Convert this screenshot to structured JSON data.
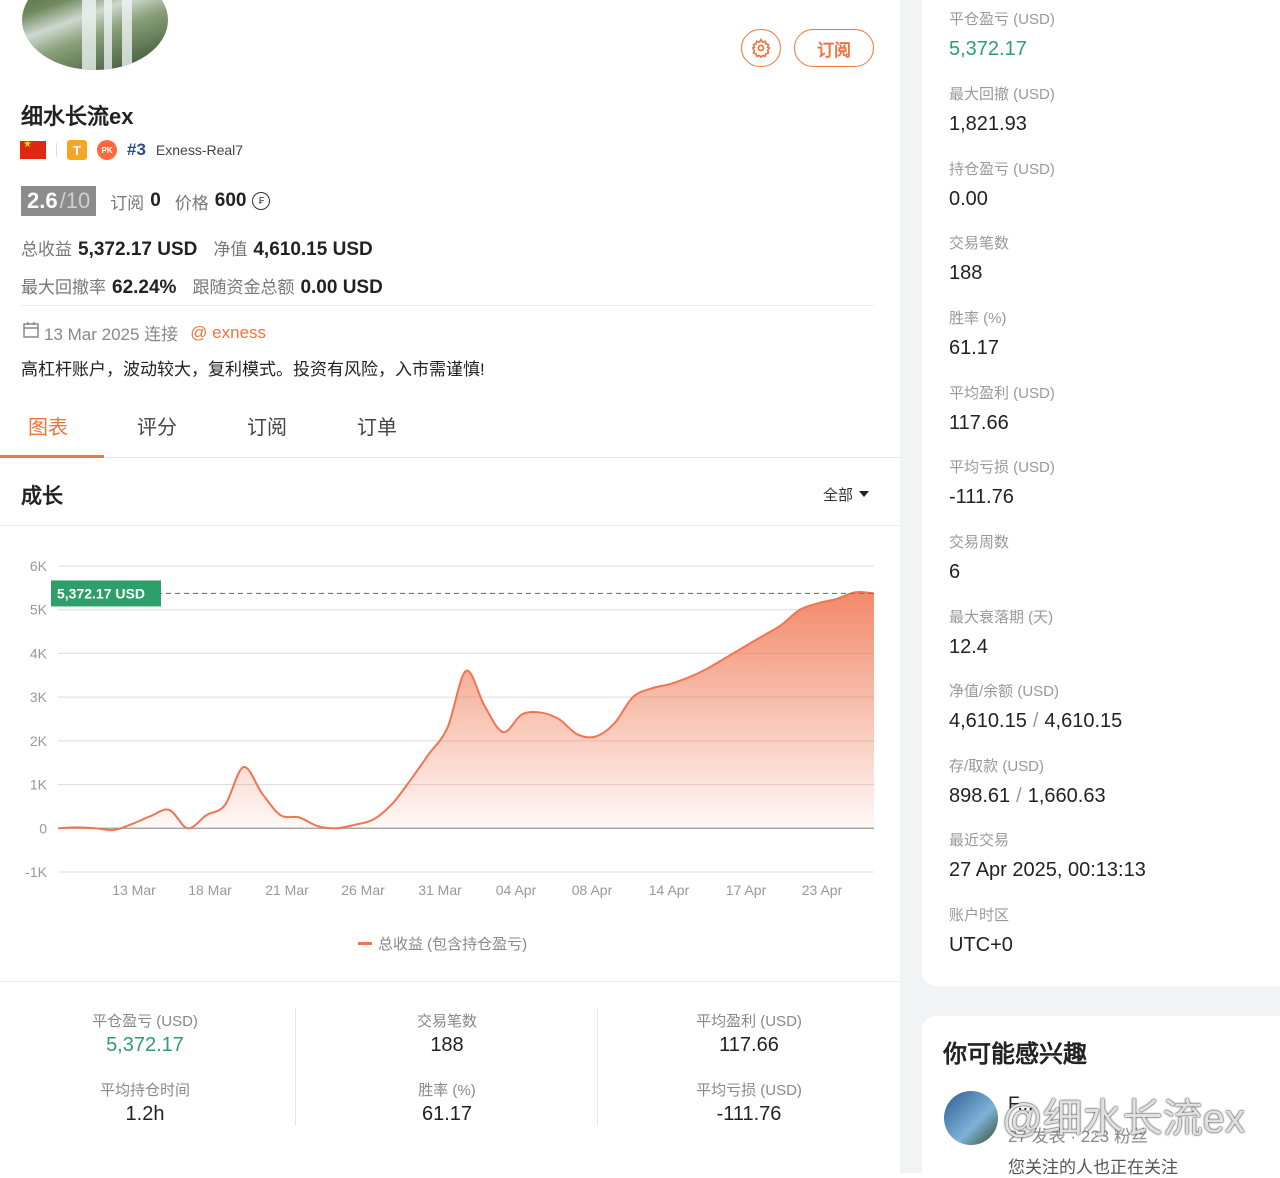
{
  "profile": {
    "name": "细水长流ex",
    "subscribe_label": "订阅",
    "tier_badge": "T",
    "pk_badge": "PK",
    "rank": "#3",
    "account": "Exness-Real7",
    "score": "2.6",
    "score_max": "/10",
    "subs_label": "订阅",
    "subs_value": "0",
    "price_label": "价格",
    "price_value": "600",
    "coin_symbol": "₣",
    "total_profit_label": "总收益",
    "total_profit_value": "5,372.17 USD",
    "equity_label": "净值",
    "equity_value": "4,610.15 USD",
    "max_dd_label": "最大回撤率",
    "max_dd_value": "62.24%",
    "follow_funds_label": "跟随资金总额",
    "follow_funds_value": "0.00 USD",
    "connect_date": "13 Mar 2025 连接",
    "broker": "@ exness",
    "description": "高杠杆账户，波动较大，复利模式。投资有风险，入市需谨慎!"
  },
  "tabs": [
    "图表",
    "评分",
    "订阅",
    "订单"
  ],
  "growth": {
    "title": "成长",
    "range_label": "全部",
    "legend": "总收益 (包含持仓盈亏)",
    "current_label": "5,372.17 USD"
  },
  "chart_data": {
    "type": "area",
    "yticks": [
      "6K",
      "5K",
      "4K",
      "3K",
      "2K",
      "1K",
      "0",
      "-1K"
    ],
    "ylim": [
      -1000,
      6000
    ],
    "xtick_labels": [
      "13 Mar",
      "18 Mar",
      "21 Mar",
      "26 Mar",
      "31 Mar",
      "04 Apr",
      "08 Apr",
      "14 Apr",
      "17 Apr",
      "23 Apr"
    ],
    "series": [
      {
        "name": "总收益 (包含持仓盈亏)",
        "color": "#f07550",
        "values": [
          0,
          20,
          0,
          -40,
          100,
          280,
          420,
          0,
          300,
          530,
          1400,
          800,
          300,
          250,
          50,
          0,
          80,
          200,
          550,
          1100,
          1700,
          2300,
          3600,
          2800,
          2200,
          2600,
          2650,
          2500,
          2150,
          2100,
          2400,
          3000,
          3200,
          3300,
          3450,
          3650,
          3900,
          4150,
          4400,
          4650,
          5000,
          5150,
          5250,
          5400,
          5372
        ]
      }
    ],
    "current_value": 5372.17,
    "grid": true
  },
  "bottom_stats": [
    {
      "label": "平仓盈亏 (USD)",
      "value": "5,372.17",
      "label2": "平均持仓时间",
      "value2": "1.2h"
    },
    {
      "label": "交易笔数",
      "value": "188",
      "label2": "胜率 (%)",
      "value2": "61.17"
    },
    {
      "label": "平均盈利 (USD)",
      "value": "117.66",
      "label2": "平均亏损 (USD)",
      "value2": "-111.76"
    }
  ],
  "side_stats": [
    {
      "label": "平仓盈亏 (USD)",
      "value": "5,372.17"
    },
    {
      "label": "最大回撤 (USD)",
      "value": "1,821.93"
    },
    {
      "label": "持仓盈亏 (USD)",
      "value": "0.00"
    },
    {
      "label": "交易笔数",
      "value": "188"
    },
    {
      "label": "胜率 (%)",
      "value": "61.17"
    },
    {
      "label": "平均盈利 (USD)",
      "value": "117.66"
    },
    {
      "label": "平均亏损 (USD)",
      "value": "-111.76"
    },
    {
      "label": "交易周数",
      "value": "6"
    },
    {
      "label": "最大衰落期 (天)",
      "value": "12.4"
    },
    {
      "label": "净值/余额 (USD)",
      "value": "4,610.15",
      "value_b": "4,610.15"
    },
    {
      "label": "存/取款 (USD)",
      "value": "898.61",
      "value_b": "1,660.63"
    },
    {
      "label": "最近交易",
      "value": "27 Apr 2025, 00:13:13"
    },
    {
      "label": "账户时区",
      "value": "UTC+0"
    }
  ],
  "suggest": {
    "title": "你可能感兴趣",
    "name": "F...",
    "sub": "27 发表 · 223 粉丝",
    "note": "您关注的人也正在关注",
    "watermark": "@细水长流ex"
  },
  "colors": {
    "accent": "#f0743e",
    "positive": "#2e9e6b",
    "line": "#f07550"
  }
}
